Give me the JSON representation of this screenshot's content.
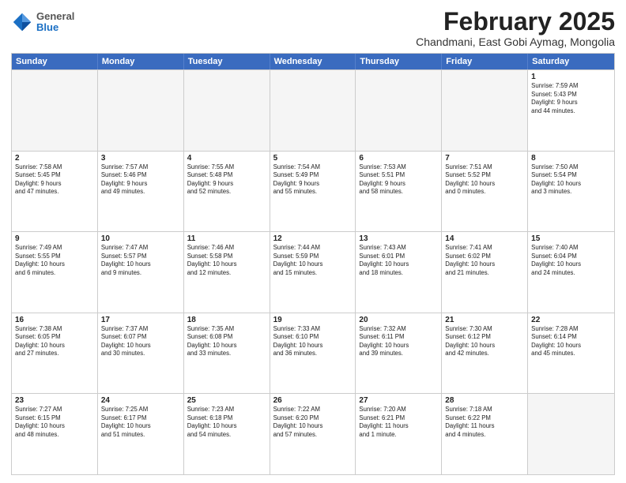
{
  "header": {
    "logo": {
      "general": "General",
      "blue": "Blue"
    },
    "month": "February 2025",
    "location": "Chandmani, East Gobi Aymag, Mongolia"
  },
  "days_of_week": [
    "Sunday",
    "Monday",
    "Tuesday",
    "Wednesday",
    "Thursday",
    "Friday",
    "Saturday"
  ],
  "rows": [
    [
      {
        "num": "",
        "info": "",
        "empty": true
      },
      {
        "num": "",
        "info": "",
        "empty": true
      },
      {
        "num": "",
        "info": "",
        "empty": true
      },
      {
        "num": "",
        "info": "",
        "empty": true
      },
      {
        "num": "",
        "info": "",
        "empty": true
      },
      {
        "num": "",
        "info": "",
        "empty": true
      },
      {
        "num": "1",
        "info": "Sunrise: 7:59 AM\nSunset: 5:43 PM\nDaylight: 9 hours\nand 44 minutes.",
        "empty": false
      }
    ],
    [
      {
        "num": "2",
        "info": "Sunrise: 7:58 AM\nSunset: 5:45 PM\nDaylight: 9 hours\nand 47 minutes.",
        "empty": false
      },
      {
        "num": "3",
        "info": "Sunrise: 7:57 AM\nSunset: 5:46 PM\nDaylight: 9 hours\nand 49 minutes.",
        "empty": false
      },
      {
        "num": "4",
        "info": "Sunrise: 7:55 AM\nSunset: 5:48 PM\nDaylight: 9 hours\nand 52 minutes.",
        "empty": false
      },
      {
        "num": "5",
        "info": "Sunrise: 7:54 AM\nSunset: 5:49 PM\nDaylight: 9 hours\nand 55 minutes.",
        "empty": false
      },
      {
        "num": "6",
        "info": "Sunrise: 7:53 AM\nSunset: 5:51 PM\nDaylight: 9 hours\nand 58 minutes.",
        "empty": false
      },
      {
        "num": "7",
        "info": "Sunrise: 7:51 AM\nSunset: 5:52 PM\nDaylight: 10 hours\nand 0 minutes.",
        "empty": false
      },
      {
        "num": "8",
        "info": "Sunrise: 7:50 AM\nSunset: 5:54 PM\nDaylight: 10 hours\nand 3 minutes.",
        "empty": false
      }
    ],
    [
      {
        "num": "9",
        "info": "Sunrise: 7:49 AM\nSunset: 5:55 PM\nDaylight: 10 hours\nand 6 minutes.",
        "empty": false
      },
      {
        "num": "10",
        "info": "Sunrise: 7:47 AM\nSunset: 5:57 PM\nDaylight: 10 hours\nand 9 minutes.",
        "empty": false
      },
      {
        "num": "11",
        "info": "Sunrise: 7:46 AM\nSunset: 5:58 PM\nDaylight: 10 hours\nand 12 minutes.",
        "empty": false
      },
      {
        "num": "12",
        "info": "Sunrise: 7:44 AM\nSunset: 5:59 PM\nDaylight: 10 hours\nand 15 minutes.",
        "empty": false
      },
      {
        "num": "13",
        "info": "Sunrise: 7:43 AM\nSunset: 6:01 PM\nDaylight: 10 hours\nand 18 minutes.",
        "empty": false
      },
      {
        "num": "14",
        "info": "Sunrise: 7:41 AM\nSunset: 6:02 PM\nDaylight: 10 hours\nand 21 minutes.",
        "empty": false
      },
      {
        "num": "15",
        "info": "Sunrise: 7:40 AM\nSunset: 6:04 PM\nDaylight: 10 hours\nand 24 minutes.",
        "empty": false
      }
    ],
    [
      {
        "num": "16",
        "info": "Sunrise: 7:38 AM\nSunset: 6:05 PM\nDaylight: 10 hours\nand 27 minutes.",
        "empty": false
      },
      {
        "num": "17",
        "info": "Sunrise: 7:37 AM\nSunset: 6:07 PM\nDaylight: 10 hours\nand 30 minutes.",
        "empty": false
      },
      {
        "num": "18",
        "info": "Sunrise: 7:35 AM\nSunset: 6:08 PM\nDaylight: 10 hours\nand 33 minutes.",
        "empty": false
      },
      {
        "num": "19",
        "info": "Sunrise: 7:33 AM\nSunset: 6:10 PM\nDaylight: 10 hours\nand 36 minutes.",
        "empty": false
      },
      {
        "num": "20",
        "info": "Sunrise: 7:32 AM\nSunset: 6:11 PM\nDaylight: 10 hours\nand 39 minutes.",
        "empty": false
      },
      {
        "num": "21",
        "info": "Sunrise: 7:30 AM\nSunset: 6:12 PM\nDaylight: 10 hours\nand 42 minutes.",
        "empty": false
      },
      {
        "num": "22",
        "info": "Sunrise: 7:28 AM\nSunset: 6:14 PM\nDaylight: 10 hours\nand 45 minutes.",
        "empty": false
      }
    ],
    [
      {
        "num": "23",
        "info": "Sunrise: 7:27 AM\nSunset: 6:15 PM\nDaylight: 10 hours\nand 48 minutes.",
        "empty": false
      },
      {
        "num": "24",
        "info": "Sunrise: 7:25 AM\nSunset: 6:17 PM\nDaylight: 10 hours\nand 51 minutes.",
        "empty": false
      },
      {
        "num": "25",
        "info": "Sunrise: 7:23 AM\nSunset: 6:18 PM\nDaylight: 10 hours\nand 54 minutes.",
        "empty": false
      },
      {
        "num": "26",
        "info": "Sunrise: 7:22 AM\nSunset: 6:20 PM\nDaylight: 10 hours\nand 57 minutes.",
        "empty": false
      },
      {
        "num": "27",
        "info": "Sunrise: 7:20 AM\nSunset: 6:21 PM\nDaylight: 11 hours\nand 1 minute.",
        "empty": false
      },
      {
        "num": "28",
        "info": "Sunrise: 7:18 AM\nSunset: 6:22 PM\nDaylight: 11 hours\nand 4 minutes.",
        "empty": false
      },
      {
        "num": "",
        "info": "",
        "empty": true
      }
    ]
  ]
}
